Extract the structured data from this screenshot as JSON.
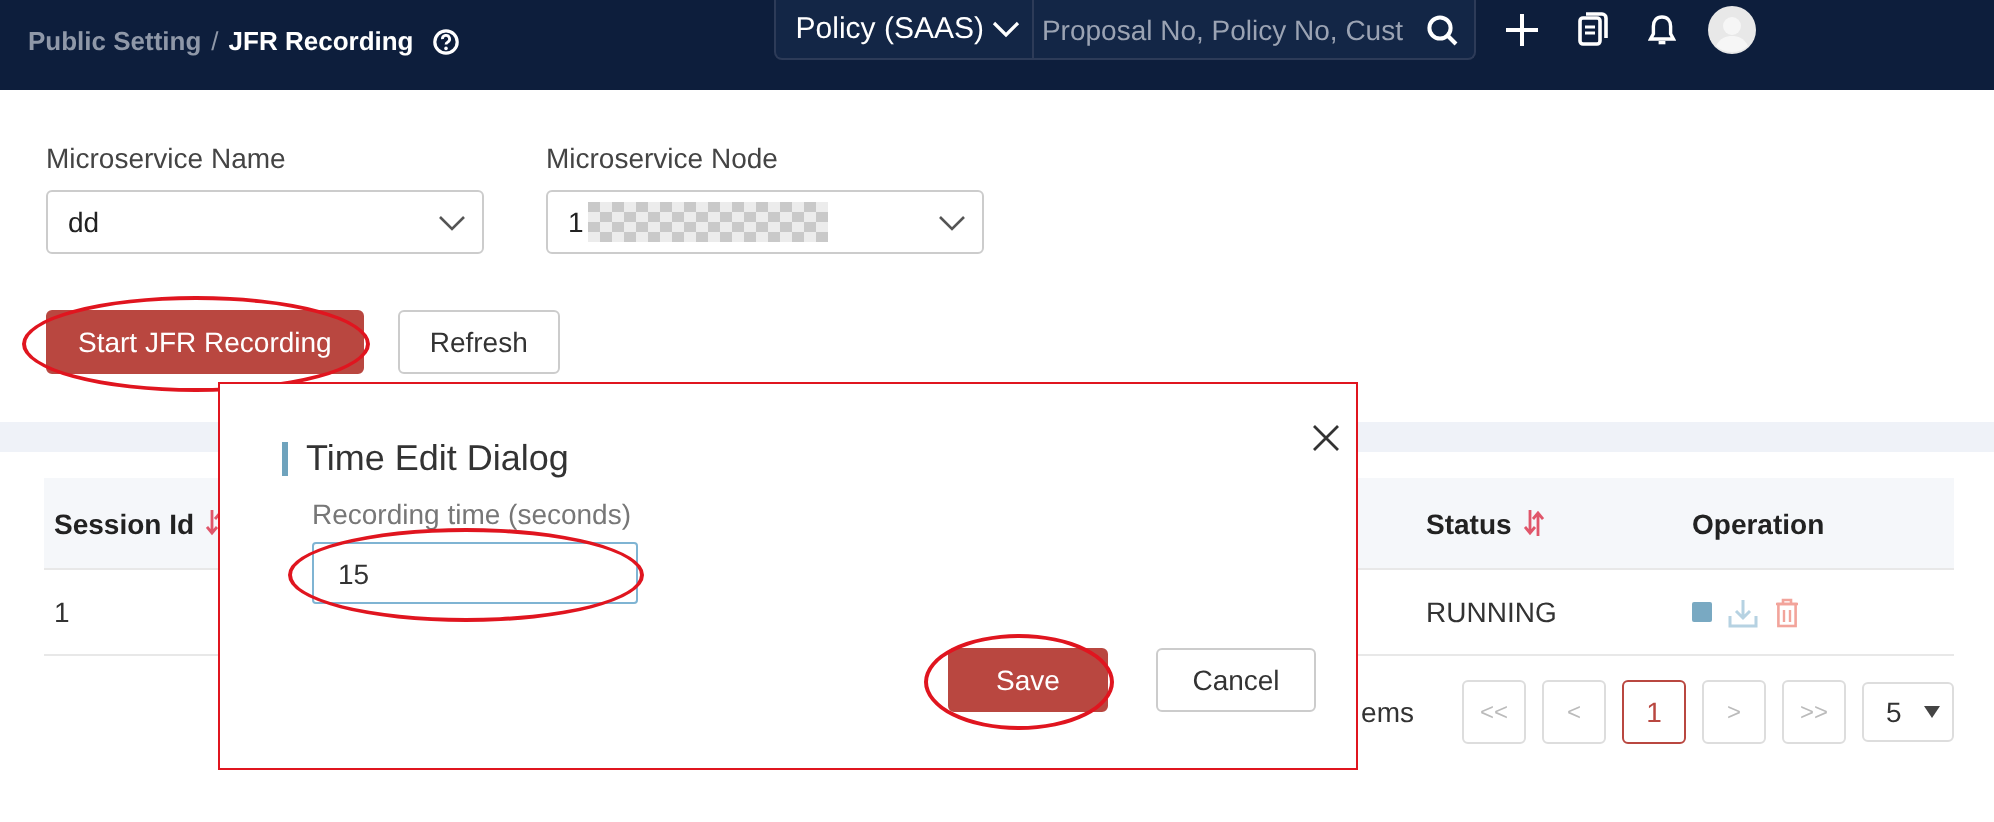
{
  "header": {
    "breadcrumb_separator": "/",
    "breadcrumb": [
      {
        "label": "Public Setting",
        "current": false
      },
      {
        "label": "JFR Recording",
        "current": true
      }
    ],
    "policy_select": {
      "value": "Policy (SAAS)"
    },
    "search": {
      "placeholder": "Proposal No, Policy No, Cust"
    }
  },
  "filters": [
    {
      "label": "Microservice Name",
      "value": "dd"
    },
    {
      "label": "Microservice Node",
      "value": "1",
      "redacted": true
    }
  ],
  "actions": [
    {
      "label": "Start JFR Recording",
      "kind": "primary",
      "circled": true
    },
    {
      "label": "Refresh",
      "kind": "default",
      "circled": false
    }
  ],
  "table": {
    "columns": [
      {
        "label": "Session Id",
        "sortable": true
      },
      {
        "label": "Status",
        "sortable": true
      },
      {
        "label": "Operation"
      }
    ],
    "rows": [
      {
        "session_id": "1",
        "status": "RUNNING"
      }
    ]
  },
  "pagination": {
    "summary_fragment": "ems",
    "pages": [
      {
        "label": "<<",
        "selected": false
      },
      {
        "label": "<",
        "selected": false
      },
      {
        "label": "1",
        "selected": true
      },
      {
        "label": ">",
        "selected": false
      },
      {
        "label": ">>",
        "selected": false
      }
    ],
    "page_size": "5"
  },
  "dialog": {
    "title": "Time Edit Dialog",
    "field_label": "Recording time (seconds)",
    "field_value": "15",
    "field_circled": true,
    "buttons": [
      {
        "label": "Save",
        "kind": "primary",
        "circled": true
      },
      {
        "label": "Cancel",
        "kind": "default",
        "circled": false
      }
    ]
  }
}
